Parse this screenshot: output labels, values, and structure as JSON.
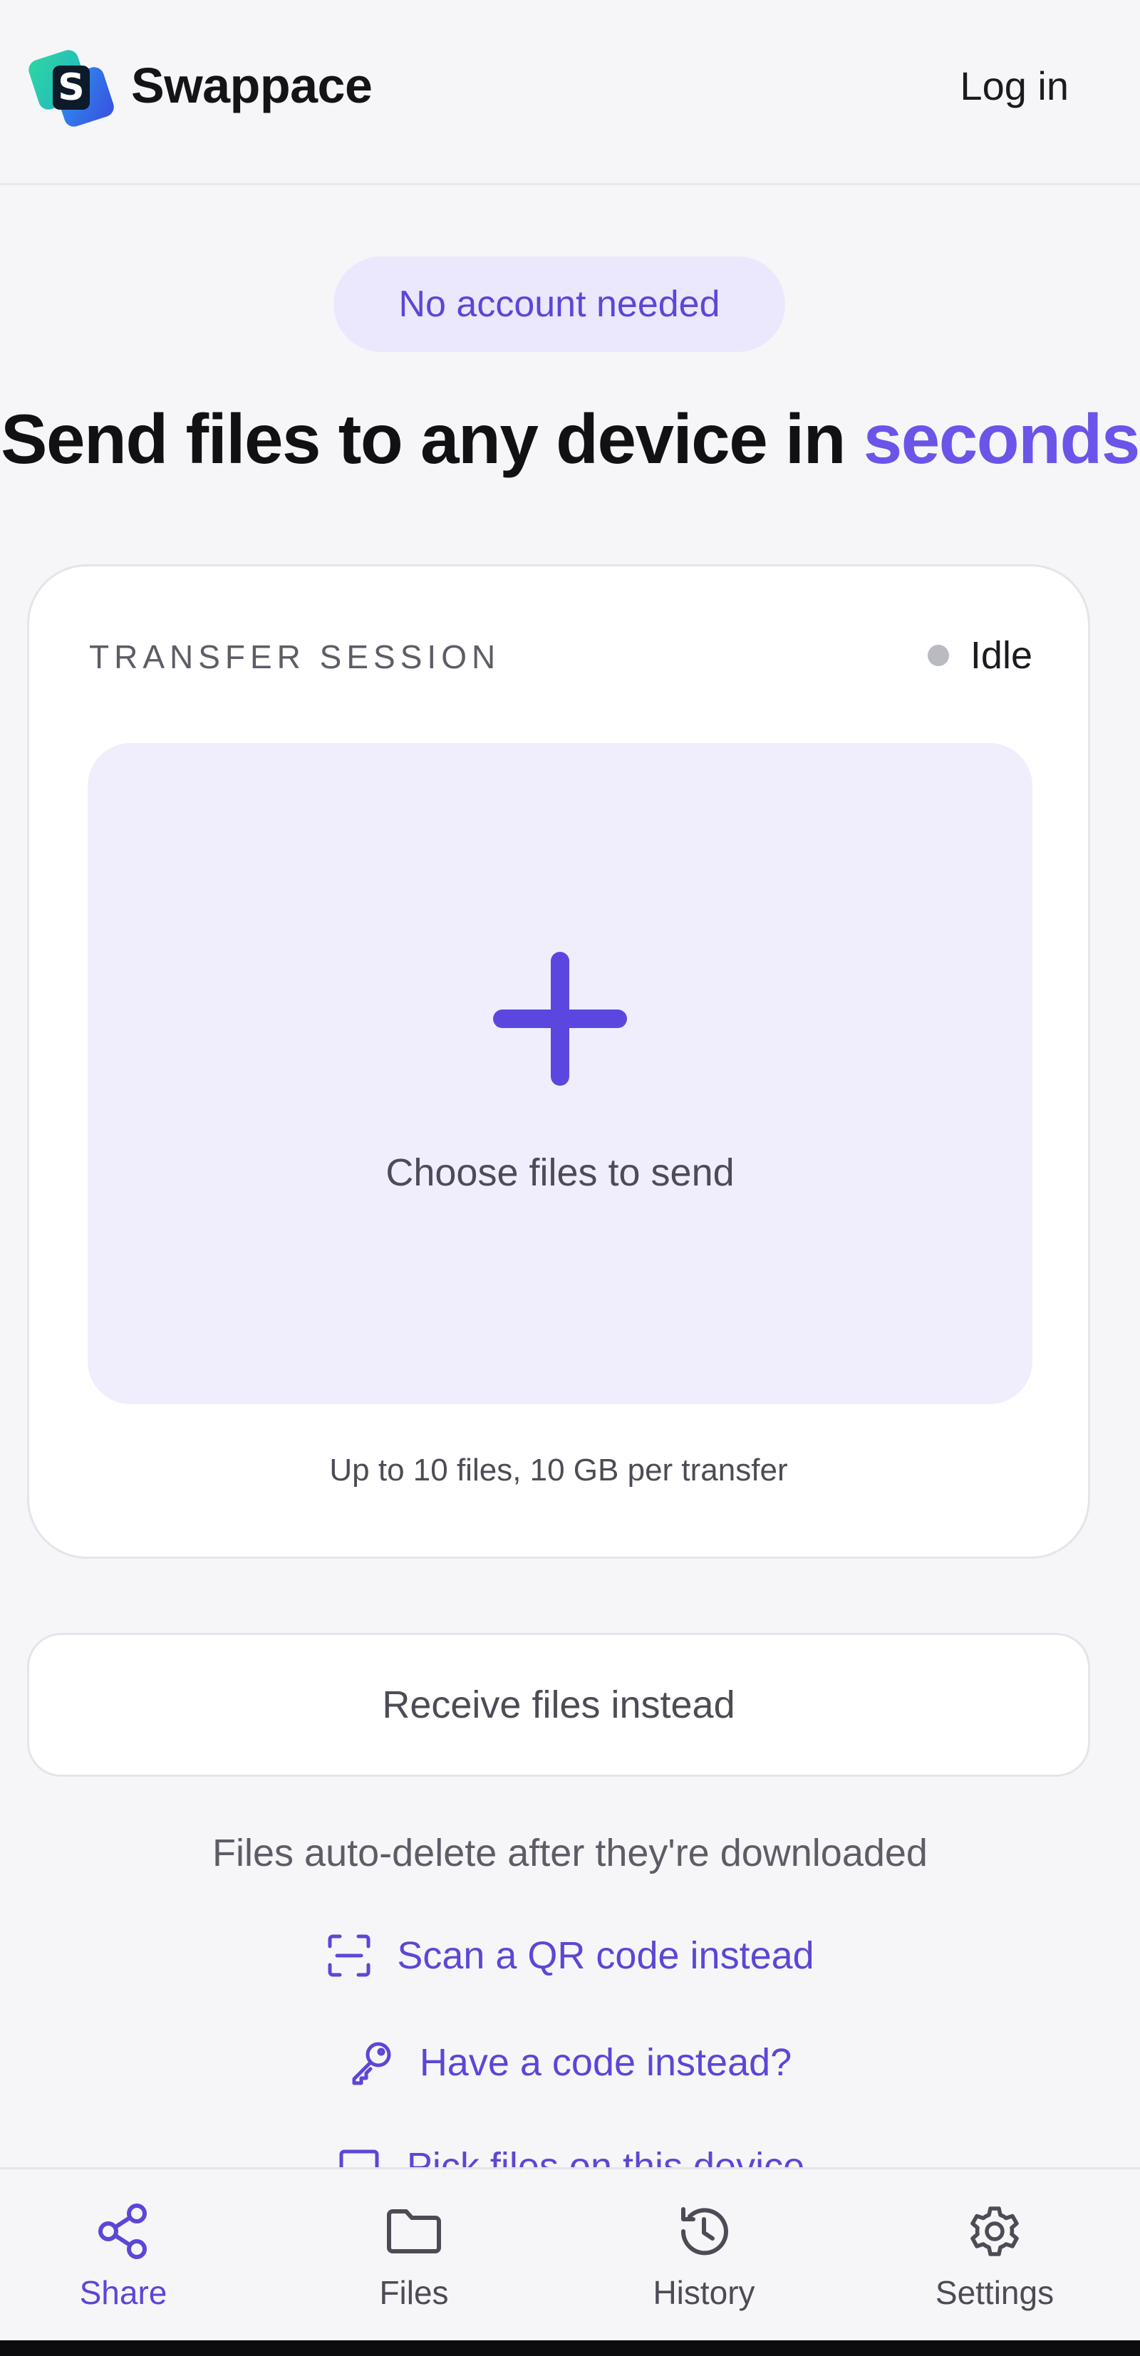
{
  "header": {
    "brand": "Swappace",
    "login_label": "Log in"
  },
  "hero": {
    "pill": "No account needed",
    "headline_main": "Send files to any device in ",
    "headline_accent": "seconds"
  },
  "session": {
    "label": "TRANSFER SESSION",
    "status": "Idle",
    "dropzone_label": "Choose files to send",
    "limits": "Up to 10 files, 10 GB per transfer"
  },
  "actions": {
    "receive_label": "Receive files instead",
    "autodelete_note": "Files auto-delete after they're downloaded",
    "qr_link": "Scan a QR code instead",
    "code_link": "Have a code instead?",
    "pick_link": "Pick files on this device"
  },
  "nav": {
    "items": [
      {
        "label": "Share",
        "icon": "share-icon",
        "active": true
      },
      {
        "label": "Files",
        "icon": "folder-icon",
        "active": false
      },
      {
        "label": "History",
        "icon": "history-icon",
        "active": false
      },
      {
        "label": "Settings",
        "icon": "gear-icon",
        "active": false
      }
    ]
  },
  "colors": {
    "accent": "#6a55e8",
    "accent_text": "#5b47d6",
    "pill_bg": "#ebe7fd",
    "dropzone_bg": "#f0eefc",
    "status_idle": "#b9bac2",
    "logo_teal": "#28c8a8",
    "logo_blue": "#2f6df0"
  }
}
